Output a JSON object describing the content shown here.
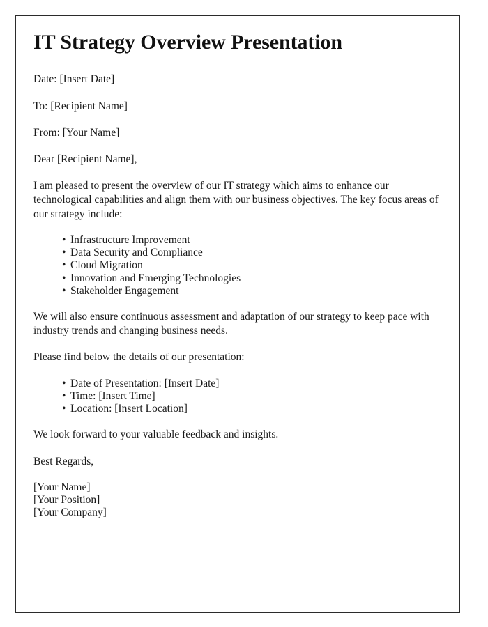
{
  "document": {
    "title": "IT Strategy Overview Presentation",
    "bullet_glyph": "•",
    "border_color": "#2b2b2b",
    "text_color": "#1a1a1a",
    "background_color": "#ffffff",
    "meta": {
      "date_line": "Date: [Insert Date]",
      "to_line": "To: [Recipient Name]",
      "from_line": "From: [Your Name]"
    },
    "salutation": "Dear [Recipient Name],",
    "intro_paragraph": "I am pleased to present the overview of our IT strategy which aims to enhance our technological capabilities and align them with our business objectives. The key focus areas of our strategy include:",
    "focus_areas": [
      "Infrastructure Improvement",
      "Data Security and Compliance",
      "Cloud Migration",
      "Innovation and Emerging Technologies",
      "Stakeholder Engagement"
    ],
    "assessment_paragraph": "We will also ensure continuous assessment and adaptation of our strategy to keep pace with industry trends and changing business needs.",
    "details_intro": "Please find below the details of our presentation:",
    "presentation_details": [
      "Date of Presentation: [Insert Date]",
      "Time: [Insert Time]",
      "Location: [Insert Location]"
    ],
    "closing_paragraph": "We look forward to your valuable feedback and insights.",
    "sign_off": "Best Regards,",
    "signature": [
      "[Your Name]",
      "[Your Position]",
      "[Your Company]"
    ]
  }
}
